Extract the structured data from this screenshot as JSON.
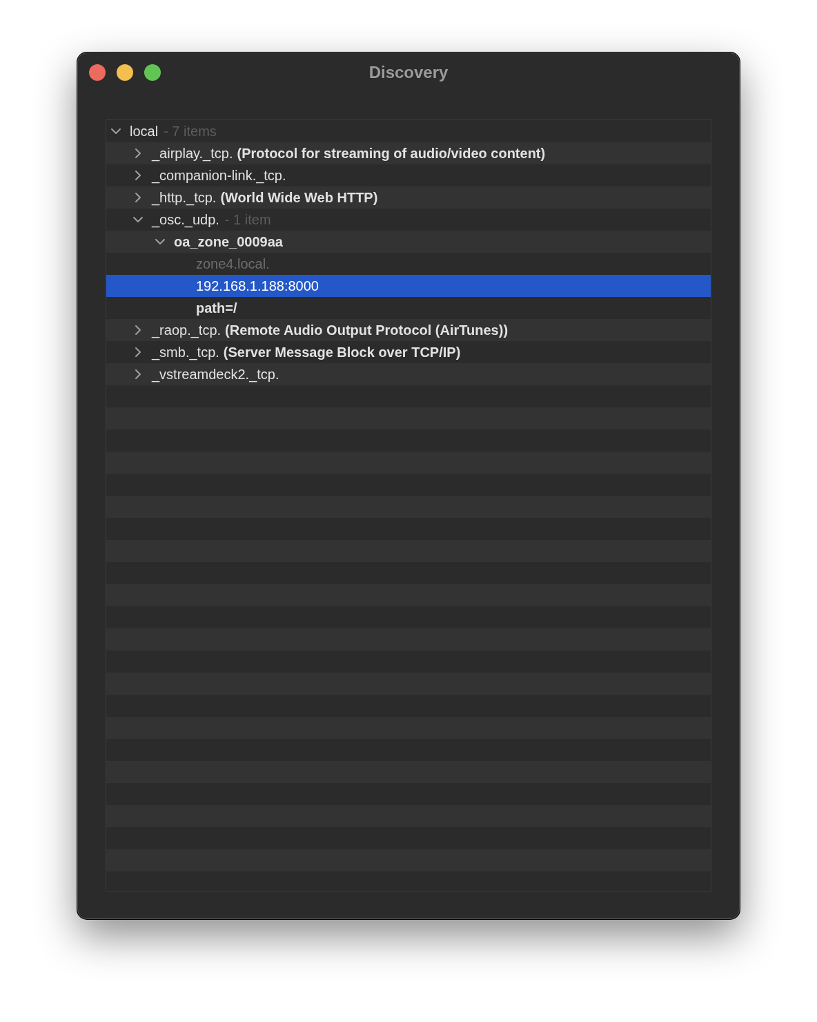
{
  "window": {
    "title": "Discovery"
  },
  "tree": [
    {
      "kind": "group",
      "name": "local",
      "count": "- 7 items",
      "expanded": true,
      "selected": false,
      "children": [
        {
          "kind": "group",
          "name": "_airplay._tcp.",
          "description": "(Protocol for streaming of audio/video content)",
          "expanded": false,
          "selected": false
        },
        {
          "kind": "group",
          "name": "_companion-link._tcp.",
          "expanded": false,
          "selected": false
        },
        {
          "kind": "group",
          "name": "_http._tcp.",
          "description": "(World Wide Web HTTP)",
          "expanded": false,
          "selected": false
        },
        {
          "kind": "group",
          "name": "_osc._udp.",
          "count": "- 1 item",
          "expanded": true,
          "selected": false,
          "children": [
            {
              "kind": "instance",
              "name": "oa_zone_0009aa",
              "expanded": true,
              "selected": false,
              "children": [
                {
                  "kind": "host",
                  "name": "zone4.local.",
                  "selected": false
                },
                {
                  "kind": "address",
                  "name": "192.168.1.188:8000",
                  "selected": true
                },
                {
                  "kind": "record",
                  "name": "path=/",
                  "selected": false
                }
              ]
            }
          ]
        },
        {
          "kind": "group",
          "name": "_raop._tcp.",
          "description": "(Remote Audio Output Protocol (AirTunes))",
          "expanded": false,
          "selected": false
        },
        {
          "kind": "group",
          "name": "_smb._tcp.",
          "description": "(Server Message Block over TCP/IP)",
          "expanded": false,
          "selected": false
        },
        {
          "kind": "group",
          "name": "_vstreamdeck2._tcp.",
          "expanded": false,
          "selected": false
        }
      ]
    }
  ]
}
